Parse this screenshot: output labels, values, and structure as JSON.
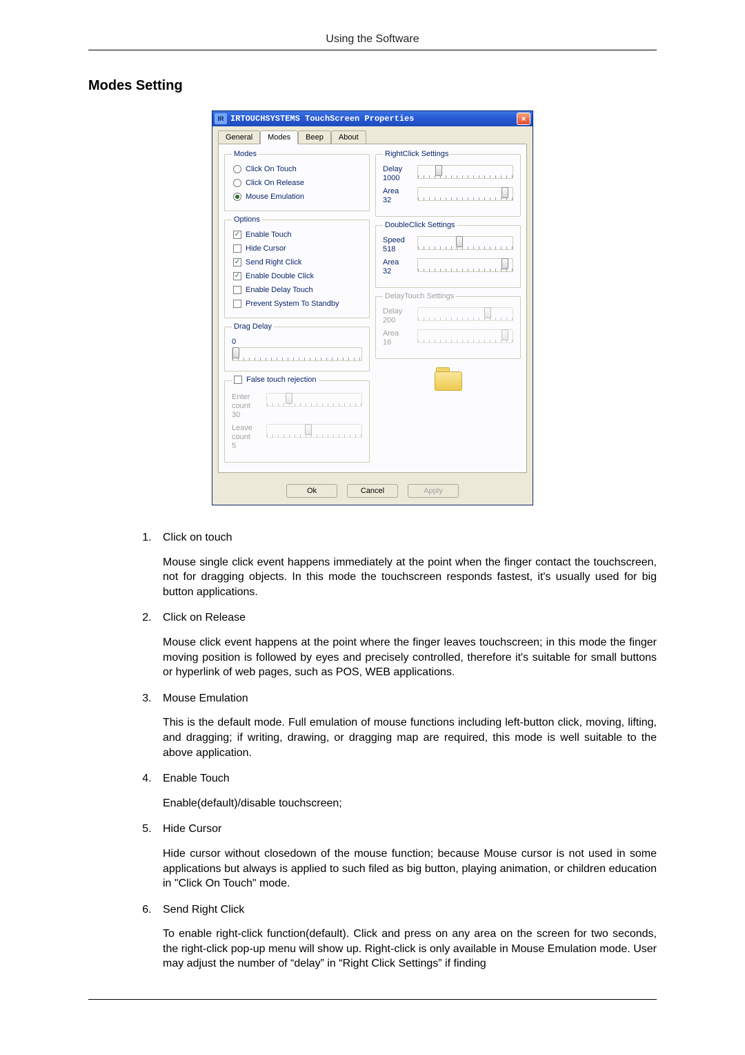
{
  "header": "Using the Software",
  "section_title": "Modes Setting",
  "dialog": {
    "title": "IRTOUCHSYSTEMS TouchScreen Properties",
    "close": "×",
    "tabs": [
      "General",
      "Modes",
      "Beep",
      "About"
    ],
    "modes_group": {
      "legend": "Modes",
      "radios": [
        {
          "label": "Click On Touch",
          "selected": false
        },
        {
          "label": "Click On Release",
          "selected": false
        },
        {
          "label": "Mouse Emulation",
          "selected": true
        }
      ]
    },
    "options_group": {
      "legend": "Options",
      "checks": [
        {
          "label": "Enable Touch",
          "checked": true
        },
        {
          "label": "Hide Cursor",
          "checked": false
        },
        {
          "label": "Send Right Click",
          "checked": true
        },
        {
          "label": "Enable Double Click",
          "checked": true
        },
        {
          "label": "Enable Delay Touch",
          "checked": false
        },
        {
          "label": "Prevent System To Standby",
          "checked": false
        }
      ]
    },
    "drag_delay": {
      "legend": "Drag Delay",
      "value": "0"
    },
    "false_touch": {
      "legend": "False touch rejection",
      "checked": false,
      "enter": {
        "label": "Enter count",
        "value": "30"
      },
      "leave": {
        "label": "Leave count",
        "value": "5"
      }
    },
    "right_click": {
      "legend": "RightClick Settings",
      "delay": {
        "label": "Delay",
        "value": "1000"
      },
      "area": {
        "label": "Area",
        "value": "32"
      }
    },
    "double_click": {
      "legend": "DoubleClick Settings",
      "speed": {
        "label": "Speed",
        "value": "518"
      },
      "area": {
        "label": "Area",
        "value": "32"
      }
    },
    "delay_touch": {
      "legend": "DelayTouch Settings",
      "delay": {
        "label": "Delay",
        "value": "200"
      },
      "area": {
        "label": "Area",
        "value": "16"
      }
    },
    "buttons": {
      "ok": "Ok",
      "cancel": "Cancel",
      "apply": "Apply"
    }
  },
  "items": [
    {
      "title": "Click on touch",
      "body": "Mouse single click event happens immediately at the point when the finger contact the touchscreen, not for dragging objects. In this mode the touchscreen responds fastest, it's usually used for big button applications."
    },
    {
      "title": "Click on Release",
      "body": "Mouse click event happens at the point where the finger leaves touchscreen; in this mode the finger moving position is followed by eyes and precisely controlled, therefore it's suitable for small buttons or hyperlink of web pages, such as POS, WEB applications."
    },
    {
      "title": "Mouse Emulation",
      "body": "This is the default mode. Full emulation of mouse functions including left-button click, moving, lifting, and dragging; if writing, drawing, or dragging map are required, this mode is well suitable to the above application."
    },
    {
      "title": "Enable Touch",
      "body": "Enable(default)/disable touchscreen;"
    },
    {
      "title": "Hide Cursor",
      "body": "Hide cursor without closedown of the mouse function; because Mouse cursor is not used in some applications but always is applied to such filed as big button, playing animation, or children education in \"Click On Touch\" mode."
    },
    {
      "title": "Send Right Click",
      "body": "To enable right-click function(default). Click and press on any area on the screen for two seconds, the right-click pop-up menu will show up. Right-click is only available in Mouse Emulation mode. User may adjust the number of “delay” in “Right Click Settings” if finding"
    }
  ]
}
